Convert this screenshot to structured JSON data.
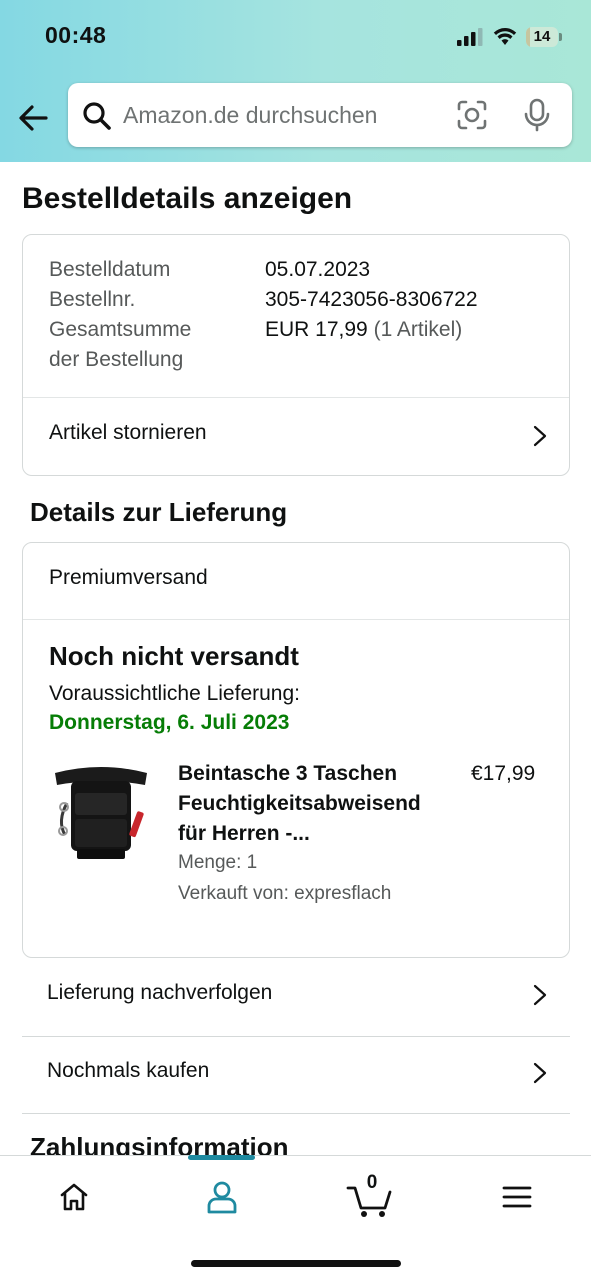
{
  "status_bar": {
    "time": "00:48",
    "battery": "14",
    "battery_level": 0.14
  },
  "header": {
    "search_placeholder": "Amazon.de durchsuchen"
  },
  "page_title": "Bestelldetails anzeigen",
  "order_summary": {
    "date_label": "Bestelldatum",
    "date_value": "05.07.2023",
    "number_label": "Bestellnr.",
    "number_value": "305-7423056-8306722",
    "total_label_line1": "Gesamtsumme",
    "total_label_line2": "der Bestellung",
    "total_value": "EUR 17,99",
    "total_items": "(1 Artikel)",
    "cancel_label": "Artikel stornieren"
  },
  "delivery": {
    "section_title": "Details zur Lieferung",
    "shipping_method": "Premiumversand",
    "status": "Noch nicht versandt",
    "eta_label": "Voraussichtliche Lieferung:",
    "eta_date": "Donnerstag, 6. Juli 2023",
    "product": {
      "title": "Beintasche 3 Taschen Feuchtigkeitsabweisend für Herren -...",
      "price": "€17,99",
      "quantity": "Menge: 1",
      "seller": "Verkauft von: expresflach"
    }
  },
  "actions": {
    "track_label": "Lieferung nachverfolgen",
    "buy_again_label": "Nochmals kaufen"
  },
  "payment_section_title": "Zahlungsinformation",
  "bottom_nav": {
    "cart_count": "0",
    "active_tab": "account"
  },
  "colors": {
    "header_gradient_start": "#84d8e3",
    "header_gradient_end": "#a9e7d7",
    "delivery_green": "#067d06",
    "nav_active": "#1f8aa0"
  }
}
